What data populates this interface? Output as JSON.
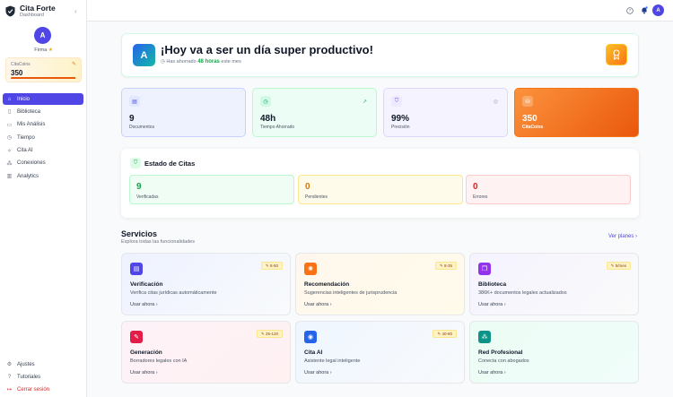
{
  "sidebar": {
    "app_name": "Cita Forte",
    "app_sub": "Dashboard",
    "avatar_letter": "A",
    "plan": "Firma",
    "coins_label": "CitaCoins",
    "coins_value": "350",
    "coins_progress": 0.97,
    "nav": [
      {
        "label": "Inicio",
        "icon": "home-icon"
      },
      {
        "label": "Biblioteca",
        "icon": "book-icon"
      },
      {
        "label": "Mis Análisis",
        "icon": "file-icon"
      },
      {
        "label": "Tiempo",
        "icon": "clock-icon"
      },
      {
        "label": "Cita AI",
        "icon": "sparkle-icon"
      },
      {
        "label": "Conexiones",
        "icon": "network-icon"
      },
      {
        "label": "Analytics",
        "icon": "bar-chart-icon"
      }
    ],
    "bottom": [
      {
        "label": "Ajustes",
        "icon": "gear-icon"
      },
      {
        "label": "Tutoriales",
        "icon": "help-icon"
      },
      {
        "label": "Cerrar sesión",
        "icon": "logout-icon"
      }
    ]
  },
  "topbar": {
    "avatar_letter": "A"
  },
  "welcome": {
    "avatar_letter": "A",
    "title": "¡Hoy va a ser un día super productivo!",
    "sub_pre": "Has ahorrado",
    "sub_hours": "48 horas",
    "sub_post": "este mes"
  },
  "stats": [
    {
      "value": "9",
      "label": "Documentos"
    },
    {
      "value": "48h",
      "label": "Tiempo Ahorrado"
    },
    {
      "value": "99%",
      "label": "Precisión"
    },
    {
      "value": "350",
      "label": "CitaCoins"
    }
  ],
  "estado": {
    "title": "Estado de Citas",
    "items": [
      {
        "value": "9",
        "label": "Verificadas"
      },
      {
        "value": "0",
        "label": "Pendientes"
      },
      {
        "value": "0",
        "label": "Errores"
      }
    ]
  },
  "services": {
    "title": "Servicios",
    "subtitle": "Explora todas las funcionalidades",
    "more": "Ver planes",
    "cards": [
      {
        "title": "Verificación",
        "desc": "Verifica citas jurídicas automáticamente",
        "badge": "8-50",
        "link": "Usar ahora"
      },
      {
        "title": "Recomendación",
        "desc": "Sugerencias inteligentes de jurisprudencia",
        "badge": "8-35",
        "link": "Usar ahora"
      },
      {
        "title": "Biblioteca",
        "desc": "386K+ documentos legales actualizados",
        "badge": "5/mes",
        "link": "Usar ahora"
      },
      {
        "title": "Generación",
        "desc": "Borradores legales con IA",
        "badge": "25-120",
        "link": "Usar ahora"
      },
      {
        "title": "Cita AI",
        "desc": "Asistente legal inteligente",
        "badge": "40-80",
        "link": "Usar ahora"
      },
      {
        "title": "Red Profesional",
        "desc": "Conecta con abogados",
        "badge": "",
        "link": "Usar ahora"
      }
    ]
  }
}
